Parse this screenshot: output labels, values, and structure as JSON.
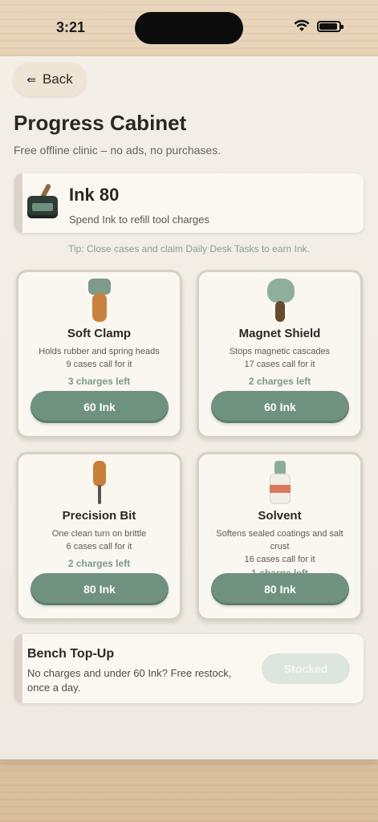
{
  "status": {
    "time": "3:21"
  },
  "nav": {
    "back_label": "Back"
  },
  "header": {
    "title": "Progress Cabinet",
    "subtitle": "Free offline clinic – no ads, no purchases."
  },
  "ink": {
    "amount_label": "Ink 80",
    "description": "Spend Ink to refill tool charges"
  },
  "tip": "Tip: Close cases and claim Daily Desk Tasks to earn Ink.",
  "tools": [
    {
      "name": "Soft Clamp",
      "desc1": "Holds rubber and spring heads",
      "desc2": "9 cases call for it",
      "charges": "3 charges left",
      "price": "60 Ink",
      "icon": "clamp-icon"
    },
    {
      "name": "Magnet Shield",
      "desc1": "Stops magnetic cascades",
      "desc2": "17 cases call for it",
      "charges": "2 charges left",
      "price": "60 Ink",
      "icon": "magnet-shield-icon"
    },
    {
      "name": "Precision Bit",
      "desc1": "One clean turn on brittle",
      "desc2": "6 cases call for it",
      "charges": "2 charges left",
      "price": "80 Ink",
      "icon": "screwdriver-icon"
    },
    {
      "name": "Solvent",
      "desc1": "Softens sealed coatings and salt",
      "desc2": "crust",
      "desc3": "16 cases call for it",
      "charges": "1 charge left",
      "price": "80 Ink",
      "icon": "bottle-icon"
    }
  ],
  "bench": {
    "title": "Bench Top-Up",
    "text": "No charges and under 60 Ink? Free restock, once a day.",
    "button_label": "Stocked"
  },
  "colors": {
    "accent": "#6f917f",
    "charges_text": "#7b9a88",
    "sheet": "#f3efe7"
  }
}
